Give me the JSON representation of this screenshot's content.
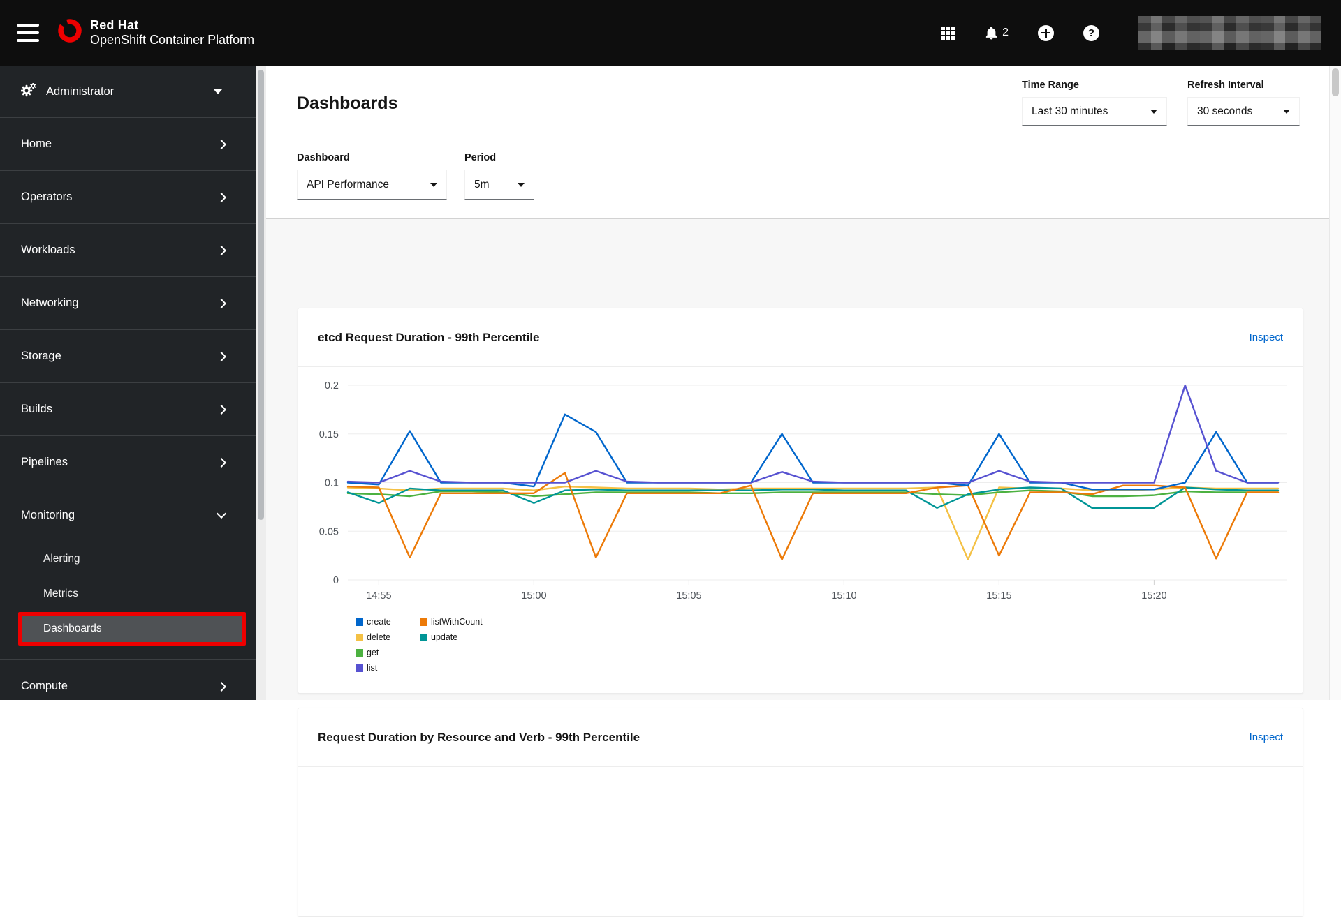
{
  "masthead": {
    "brand_line1": "Red Hat",
    "brand_line2_bold": "OpenShift",
    "brand_line2_rest": "Container Platform",
    "notification_count": "2"
  },
  "sidebar": {
    "perspective_label": "Administrator",
    "items": [
      {
        "label": "Home"
      },
      {
        "label": "Operators"
      },
      {
        "label": "Workloads"
      },
      {
        "label": "Networking"
      },
      {
        "label": "Storage"
      },
      {
        "label": "Builds"
      },
      {
        "label": "Pipelines"
      }
    ],
    "monitoring": {
      "label": "Monitoring",
      "children": [
        {
          "label": "Alerting",
          "selected": false
        },
        {
          "label": "Metrics",
          "selected": false
        },
        {
          "label": "Dashboards",
          "selected": true,
          "annotation": "red-highlight-box"
        }
      ]
    },
    "compute_label": "Compute"
  },
  "page": {
    "title": "Dashboards",
    "time_range": {
      "label": "Time Range",
      "value": "Last 30 minutes"
    },
    "refresh_interval": {
      "label": "Refresh Interval",
      "value": "30 seconds"
    },
    "dashboard_select": {
      "label": "Dashboard",
      "value": "API Performance"
    },
    "period_select": {
      "label": "Period",
      "value": "5m"
    }
  },
  "cards": [
    {
      "title": "etcd Request Duration - 99th Percentile",
      "action": "Inspect"
    },
    {
      "title": "Request Duration by Resource and Verb - 99th Percentile",
      "action": "Inspect"
    }
  ],
  "chart_data": {
    "type": "line",
    "title": "etcd Request Duration - 99th Percentile",
    "ylabel": "",
    "xlabel": "",
    "ylim": [
      0,
      0.2
    ],
    "y_ticks": [
      0,
      0.05,
      0.1,
      0.15,
      0.2
    ],
    "grid": "horizontal",
    "legend_position": "bottom-left",
    "x_tick_labels": [
      "14:55",
      "15:00",
      "15:05",
      "15:10",
      "15:15",
      "15:20"
    ],
    "x_times": [
      "14:54",
      "14:55",
      "14:56",
      "14:57",
      "14:58",
      "14:59",
      "15:00",
      "15:01",
      "15:02",
      "15:03",
      "15:04",
      "15:05",
      "15:06",
      "15:07",
      "15:08",
      "15:09",
      "15:10",
      "15:11",
      "15:12",
      "15:13",
      "15:14",
      "15:15",
      "15:16",
      "15:17",
      "15:18",
      "15:19",
      "15:20",
      "15:21",
      "15:22",
      "15:23",
      "15:24"
    ],
    "series": [
      {
        "name": "create",
        "color": "#0066cc",
        "values": [
          0.1,
          0.098,
          0.153,
          0.1,
          0.1,
          0.1,
          0.096,
          0.17,
          0.152,
          0.1,
          0.1,
          0.1,
          0.1,
          0.1,
          0.15,
          0.1,
          0.1,
          0.1,
          0.1,
          0.1,
          0.097,
          0.15,
          0.1,
          0.1,
          0.093,
          0.093,
          0.093,
          0.1,
          0.152,
          0.1,
          0.1
        ]
      },
      {
        "name": "delete",
        "color": "#f4c145",
        "values": [
          0.095,
          0.094,
          0.092,
          0.094,
          0.094,
          0.094,
          0.092,
          0.096,
          0.095,
          0.094,
          0.094,
          0.094,
          0.093,
          0.094,
          0.094,
          0.094,
          0.094,
          0.094,
          0.094,
          0.095,
          0.021,
          0.095,
          0.094,
          0.094,
          0.092,
          0.092,
          0.093,
          0.095,
          0.094,
          0.094,
          0.094
        ]
      },
      {
        "name": "get",
        "color": "#4cb140",
        "values": [
          0.089,
          0.088,
          0.086,
          0.091,
          0.091,
          0.09,
          0.086,
          0.088,
          0.09,
          0.09,
          0.09,
          0.09,
          0.089,
          0.089,
          0.09,
          0.09,
          0.09,
          0.09,
          0.09,
          0.088,
          0.087,
          0.09,
          0.092,
          0.091,
          0.086,
          0.086,
          0.087,
          0.091,
          0.09,
          0.09,
          0.09
        ]
      },
      {
        "name": "list",
        "color": "#5752d1",
        "values": [
          0.101,
          0.1,
          0.112,
          0.101,
          0.1,
          0.1,
          0.1,
          0.1,
          0.112,
          0.101,
          0.1,
          0.1,
          0.1,
          0.1,
          0.111,
          0.101,
          0.1,
          0.1,
          0.1,
          0.1,
          0.1,
          0.112,
          0.101,
          0.1,
          0.1,
          0.1,
          0.1,
          0.2,
          0.112,
          0.1,
          0.1
        ]
      },
      {
        "name": "listWithCount",
        "color": "#ec7a08",
        "values": [
          0.096,
          0.095,
          0.023,
          0.089,
          0.089,
          0.089,
          0.089,
          0.11,
          0.023,
          0.089,
          0.089,
          0.089,
          0.089,
          0.097,
          0.021,
          0.089,
          0.089,
          0.089,
          0.089,
          0.095,
          0.097,
          0.025,
          0.09,
          0.09,
          0.088,
          0.097,
          0.097,
          0.095,
          0.022,
          0.09,
          0.09
        ]
      },
      {
        "name": "update",
        "color": "#009596",
        "values": [
          0.09,
          0.079,
          0.094,
          0.092,
          0.092,
          0.092,
          0.079,
          0.092,
          0.093,
          0.092,
          0.092,
          0.092,
          0.092,
          0.092,
          0.093,
          0.093,
          0.092,
          0.092,
          0.092,
          0.074,
          0.088,
          0.093,
          0.095,
          0.094,
          0.074,
          0.074,
          0.074,
          0.095,
          0.093,
          0.092,
          0.092
        ]
      }
    ],
    "draw_order": [
      "delete",
      "get",
      "update",
      "listWithCount",
      "create",
      "list"
    ],
    "legend_columns": [
      [
        "create",
        "delete",
        "get",
        "list"
      ],
      [
        "listWithCount",
        "update"
      ]
    ]
  }
}
